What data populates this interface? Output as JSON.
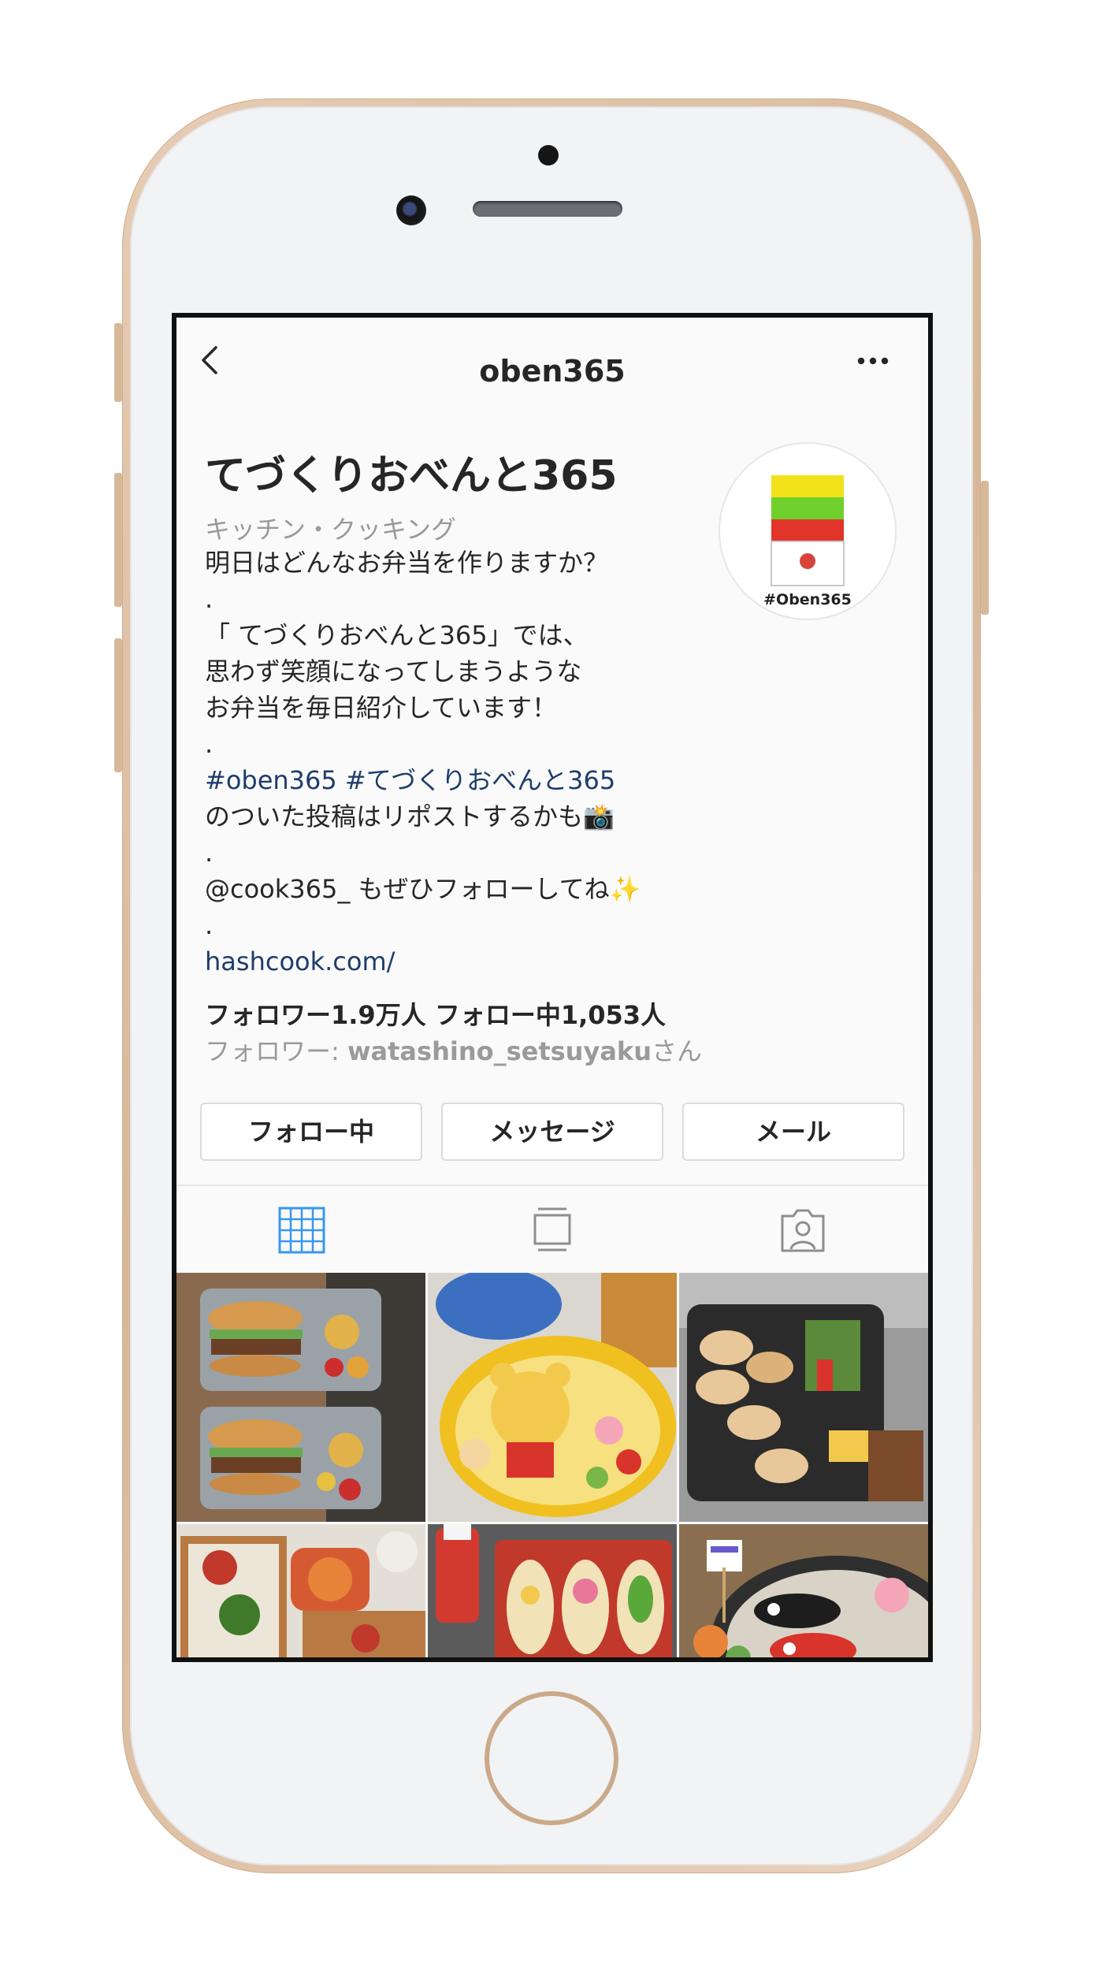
{
  "nav": {
    "username": "oben365"
  },
  "profile": {
    "display_name": "てづくりおべんと365",
    "category": "キッチン・クッキング",
    "avatar_text": "#Oben365",
    "bio": [
      "明日はどんなお弁当を作りますか？",
      ".",
      "「 てづくりおべんと365」では、",
      "思わず笑顔になってしまうような",
      "お弁当を毎日紹介しています！",
      ".",
      "#oben365 #てづくりおべんと365",
      "のついた投稿はリポストするかも📸",
      ".",
      "@cook365_ もぜひフォローしてね✨",
      ".",
      "hashcook.com/"
    ],
    "stats": "フォロワー1.9万人  フォロー中1,053人",
    "followed_by_prefix": "フォロワー: ",
    "followed_by_user": "watashino_setsuyaku",
    "followed_by_suffix": "さん"
  },
  "buttons": {
    "following": "フォロー中",
    "message": "メッセージ",
    "email": "メール"
  },
  "tabs": [
    {
      "name": "grid-view",
      "active": true
    },
    {
      "name": "feed-view",
      "active": false
    },
    {
      "name": "tagged",
      "active": false
    }
  ],
  "colors": {
    "accent": "#3897f0",
    "link": "#1d3d6b",
    "avatar_bars": [
      "#f2e21a",
      "#6fd02c",
      "#e1352b"
    ]
  },
  "posts": [
    {
      "icon": "burger-bento-photo"
    },
    {
      "icon": "pooh-bento-photo"
    },
    {
      "icon": "gyoza-bento-photo"
    },
    {
      "icon": "rice-box-bento-photo"
    },
    {
      "icon": "sandwich-bento-photo"
    },
    {
      "icon": "koinobori-bento-photo"
    }
  ]
}
